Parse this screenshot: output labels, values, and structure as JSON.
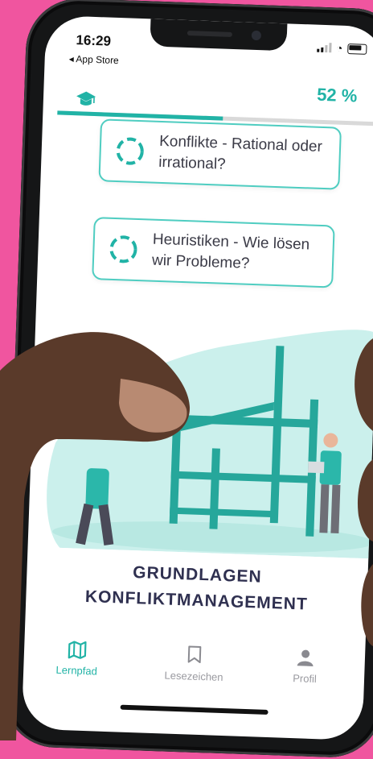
{
  "status": {
    "time": "16:29",
    "back_label": "◂ App Store"
  },
  "progress": {
    "percent_label": "52 %",
    "fraction": 0.52
  },
  "lessons": [
    {
      "title_line1": "Konflikte - Rational oder",
      "title_line2": "irrational?"
    },
    {
      "title_line1": "Heuristiken - Wie lösen",
      "title_line2": "wir Probleme?"
    }
  ],
  "course": {
    "title_line1": "GRUNDLAGEN",
    "title_line2": "KONFLIKTMANAGEMENT"
  },
  "tabs": [
    {
      "label": "Lernpfad",
      "icon": "map-icon",
      "active": true
    },
    {
      "label": "Lesezeichen",
      "icon": "bookmark-icon",
      "active": false
    },
    {
      "label": "Profil",
      "icon": "person-icon",
      "active": false
    }
  ],
  "colors": {
    "accent": "#21b3a6",
    "background": "#f0559f",
    "text_dark": "#2f3050"
  }
}
